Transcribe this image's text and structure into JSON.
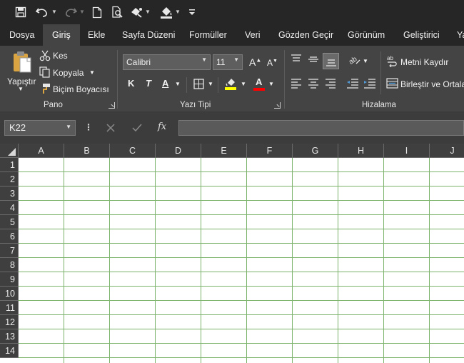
{
  "colors": {
    "titlebar": "#262626",
    "ribbon": "#444444",
    "grid_lines": "#7cb36a",
    "font_color_bar": "#ff0000",
    "highlight_bar": "#ffff00"
  },
  "quick_access": {
    "icons": [
      "save-icon",
      "undo-icon",
      "redo-icon",
      "new-document-icon",
      "print-preview-icon",
      "touch-mode-icon",
      "fill-icon",
      "customize-qat-icon"
    ]
  },
  "tabs": [
    "Dosya",
    "Giriş",
    "Ekle",
    "Sayfa Düzeni",
    "Formüller",
    "Veri",
    "Gözden Geçir",
    "Görünüm",
    "Geliştirici",
    "Ya"
  ],
  "active_tab": "Giriş",
  "ribbon": {
    "clipboard": {
      "paste": "Yapıştır",
      "cut": "Kes",
      "copy": "Kopyala",
      "format_painter": "Biçim Boyacısı",
      "label": "Pano"
    },
    "font": {
      "name": "Calibri",
      "size": "11",
      "grow": "A",
      "shrink": "A",
      "bold": "K",
      "italic": "T",
      "underline": "A",
      "font_color": "A",
      "label": "Yazı Tipi"
    },
    "alignment": {
      "wrap_text": "Metni Kaydır",
      "merge": "Birleştir ve Ortala",
      "label": "Hizalama"
    }
  },
  "formula_bar": {
    "name_box": "K22",
    "fx": "fx",
    "value": ""
  },
  "grid": {
    "columns": [
      "A",
      "B",
      "C",
      "D",
      "E",
      "F",
      "G",
      "H",
      "I",
      "J"
    ],
    "rows": [
      "1",
      "2",
      "3",
      "4",
      "5",
      "6",
      "7",
      "8",
      "9",
      "10",
      "11",
      "12",
      "13",
      "14"
    ]
  }
}
